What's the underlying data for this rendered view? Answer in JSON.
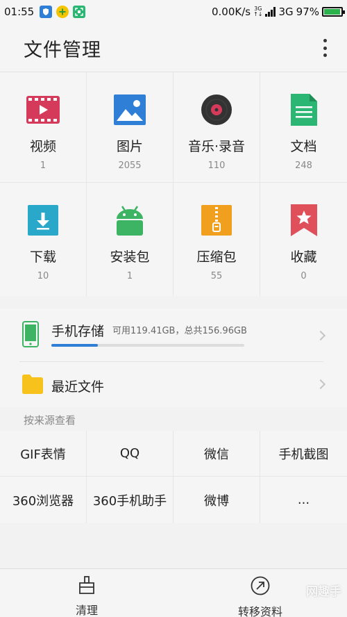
{
  "status_bar": {
    "time": "01:55",
    "network_speed": "0.00K/s",
    "network_type_small_top": "3G",
    "network_type_small_bottom": "↑↓",
    "network_type": "3G",
    "battery": "97%",
    "battery_level": 0.97,
    "app_icons": [
      "shield-app-icon",
      "plus-app-icon",
      "scan-app-icon"
    ]
  },
  "header": {
    "title": "文件管理",
    "menu_icon": "more-vertical-icon"
  },
  "categories": [
    {
      "label": "视频",
      "count": "1",
      "icon": "video-icon",
      "color": "#d63a5a"
    },
    {
      "label": "图片",
      "count": "2055",
      "icon": "image-icon",
      "color": "#2f7fd6"
    },
    {
      "label": "音乐·录音",
      "count": "110",
      "icon": "music-disc-icon",
      "color": "#333333"
    },
    {
      "label": "文档",
      "count": "248",
      "icon": "document-icon",
      "color": "#2bb673"
    },
    {
      "label": "下载",
      "count": "10",
      "icon": "download-icon",
      "color": "#2aa8c9"
    },
    {
      "label": "安装包",
      "count": "1",
      "icon": "android-icon",
      "color": "#3cb463"
    },
    {
      "label": "压缩包",
      "count": "55",
      "icon": "zip-icon",
      "color": "#f0a01e"
    },
    {
      "label": "收藏",
      "count": "0",
      "icon": "bookmark-star-icon",
      "color": "#e0505a"
    }
  ],
  "storage": {
    "phone_label": "手机存储",
    "phone_info": "可用119.41GB，总共156.96GB",
    "used_fraction": 0.24,
    "recent_label": "最近文件"
  },
  "source_section": {
    "title": "按来源查看",
    "items": [
      "GIF表情",
      "QQ",
      "微信",
      "手机截图",
      "360浏览器",
      "360手机助手",
      "微博",
      "..."
    ]
  },
  "bottom_nav": {
    "clean_label": "清理",
    "transfer_label": "转移资料"
  },
  "watermark": "网趣手"
}
